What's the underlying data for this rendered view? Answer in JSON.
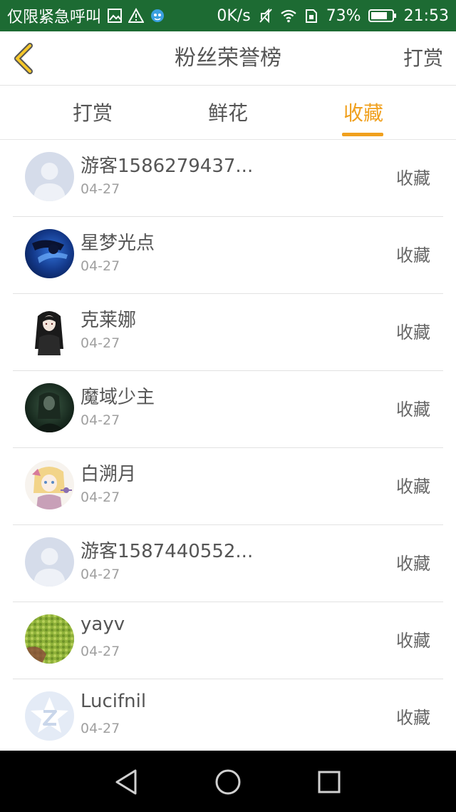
{
  "status_bar": {
    "carrier_text": "仅限紧急呼叫",
    "network_speed": "0K/s",
    "battery_percent": "73%",
    "time": "21:53",
    "background_color": "#1d6b33",
    "icons": [
      "image-icon",
      "warning-icon",
      "app-icon",
      "mute-icon",
      "wifi-icon",
      "sim-icon",
      "battery-icon"
    ]
  },
  "header": {
    "title": "粉丝荣誉榜",
    "action_label": "打赏",
    "back_icon": "chevron-left-icon",
    "accent_color": "#f0a01e"
  },
  "tabs": [
    {
      "label": "打赏",
      "active": false
    },
    {
      "label": "鲜花",
      "active": false
    },
    {
      "label": "收藏",
      "active": true
    }
  ],
  "list": {
    "items": [
      {
        "name": "游客1586279437...",
        "date": "04-27",
        "action": "收藏",
        "avatar": "default-user-avatar"
      },
      {
        "name": "星梦光点",
        "date": "04-27",
        "action": "收藏",
        "avatar": "blue-anime-avatar"
      },
      {
        "name": "克莱娜",
        "date": "04-27",
        "action": "收藏",
        "avatar": "dark-haired-girl-avatar"
      },
      {
        "name": "魔域少主",
        "date": "04-27",
        "action": "收藏",
        "avatar": "dark-green-avatar"
      },
      {
        "name": "白溯月",
        "date": "04-27",
        "action": "收藏",
        "avatar": "blonde-anime-avatar"
      },
      {
        "name": "游客1587440552...",
        "date": "04-27",
        "action": "收藏",
        "avatar": "default-user-avatar"
      },
      {
        "name": "yayv",
        "date": "04-27",
        "action": "收藏",
        "avatar": "green-texture-avatar"
      },
      {
        "name": "Lucifnil",
        "date": "04-27",
        "action": "收藏",
        "avatar": "qq-logo-avatar"
      }
    ]
  },
  "nav_bar": {
    "buttons": [
      "back-triangle-icon",
      "home-circle-icon",
      "recents-square-icon"
    ]
  }
}
